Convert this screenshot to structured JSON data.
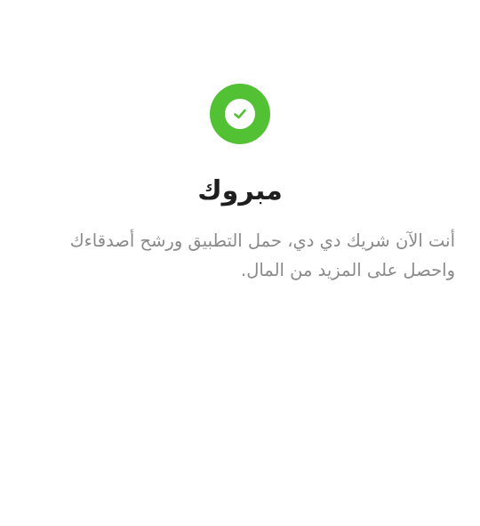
{
  "success": {
    "icon": "checkmark-circle-icon",
    "accent_color": "#52c234",
    "title": "مبروك",
    "message": "أنت الآن شريك دي دي، حمل التطبيق ورشح أصدقاءك واحصل على المزيد من المال."
  }
}
